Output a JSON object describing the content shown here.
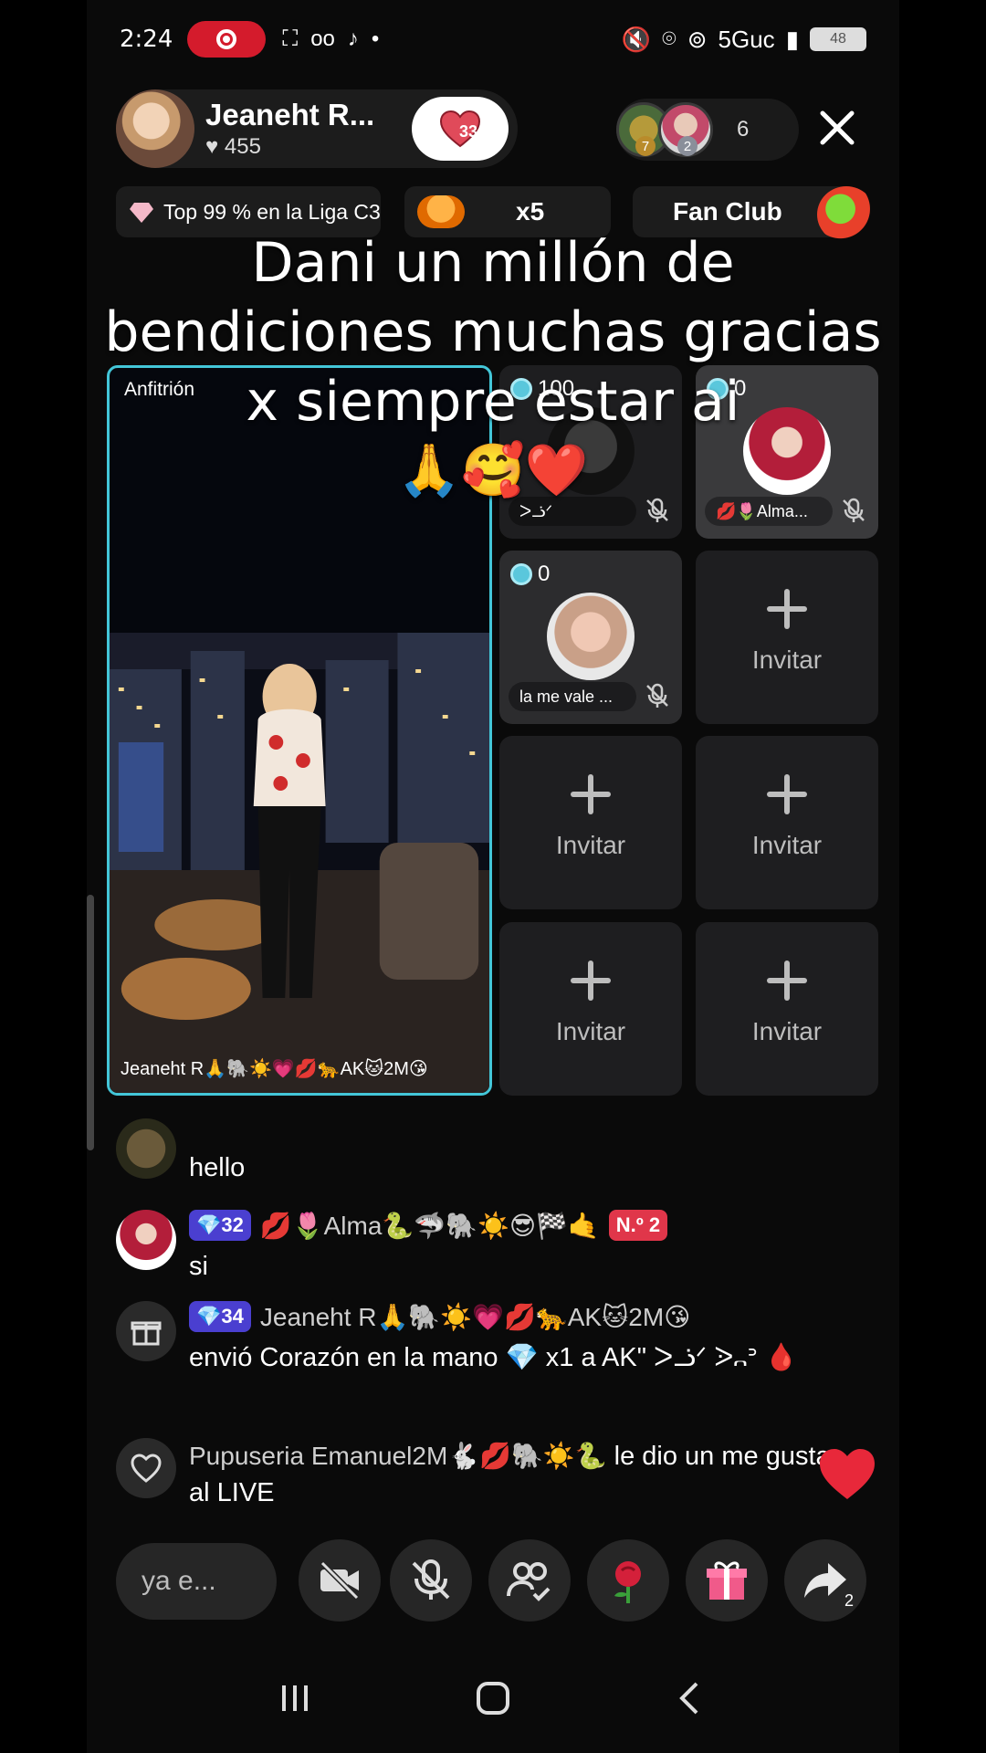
{
  "status": {
    "time": "2:24",
    "network": "5Guc",
    "battery": "48"
  },
  "host": {
    "name": "Jeaneht R...",
    "likes": "♥ 455",
    "follow_count": "33"
  },
  "viewers": {
    "count": "6",
    "rank1": "7",
    "rank2": "2"
  },
  "chips": {
    "league": "Top 99 % en la Liga C3",
    "multiplier": "x5",
    "fan_club": "Fan Club"
  },
  "caption": {
    "text": "Dani un millón de bendiciones muchas gracias x siempre estar ai",
    "emoji": "🙏🥰❤️"
  },
  "grid": {
    "host_label": "Anfitrión",
    "host_tag": "Jeaneht R🙏🐘☀️💗💋🐆AK🐱2M😘",
    "guests": [
      {
        "score": "100",
        "name": "ᐳᓘᐟ"
      },
      {
        "score": "0",
        "name": "💋🌷Alma..."
      },
      {
        "score": "0",
        "name": "la me vale ..."
      }
    ],
    "invite_label": "Invitar"
  },
  "chat": [
    {
      "text": "hello"
    },
    {
      "badge": "32",
      "name": "💋🌷Alma🐍🦈🐘☀️😎🏁🤙",
      "rank": "N.º 2",
      "text": "si"
    },
    {
      "badge": "34",
      "name": "Jeaneht R🙏🐘☀️💗💋🐆AK🐱2M😘",
      "text": "envió Corazón en la mano 💎 x1 a AK\" ᐳᓘᐟ ᐷ᎔ᐣ 🩸"
    },
    {
      "name": "Pupuseria Emanuel2M🐇💋🐘☀️🐍",
      "text": "le dio un me gusta al LIVE"
    }
  ],
  "bottom": {
    "comment_placeholder": "ya e...",
    "share_count": "2"
  },
  "colors": {
    "accent_border": "#43c6d8",
    "record": "#d41b2c",
    "badge": "#4a3fd0"
  }
}
